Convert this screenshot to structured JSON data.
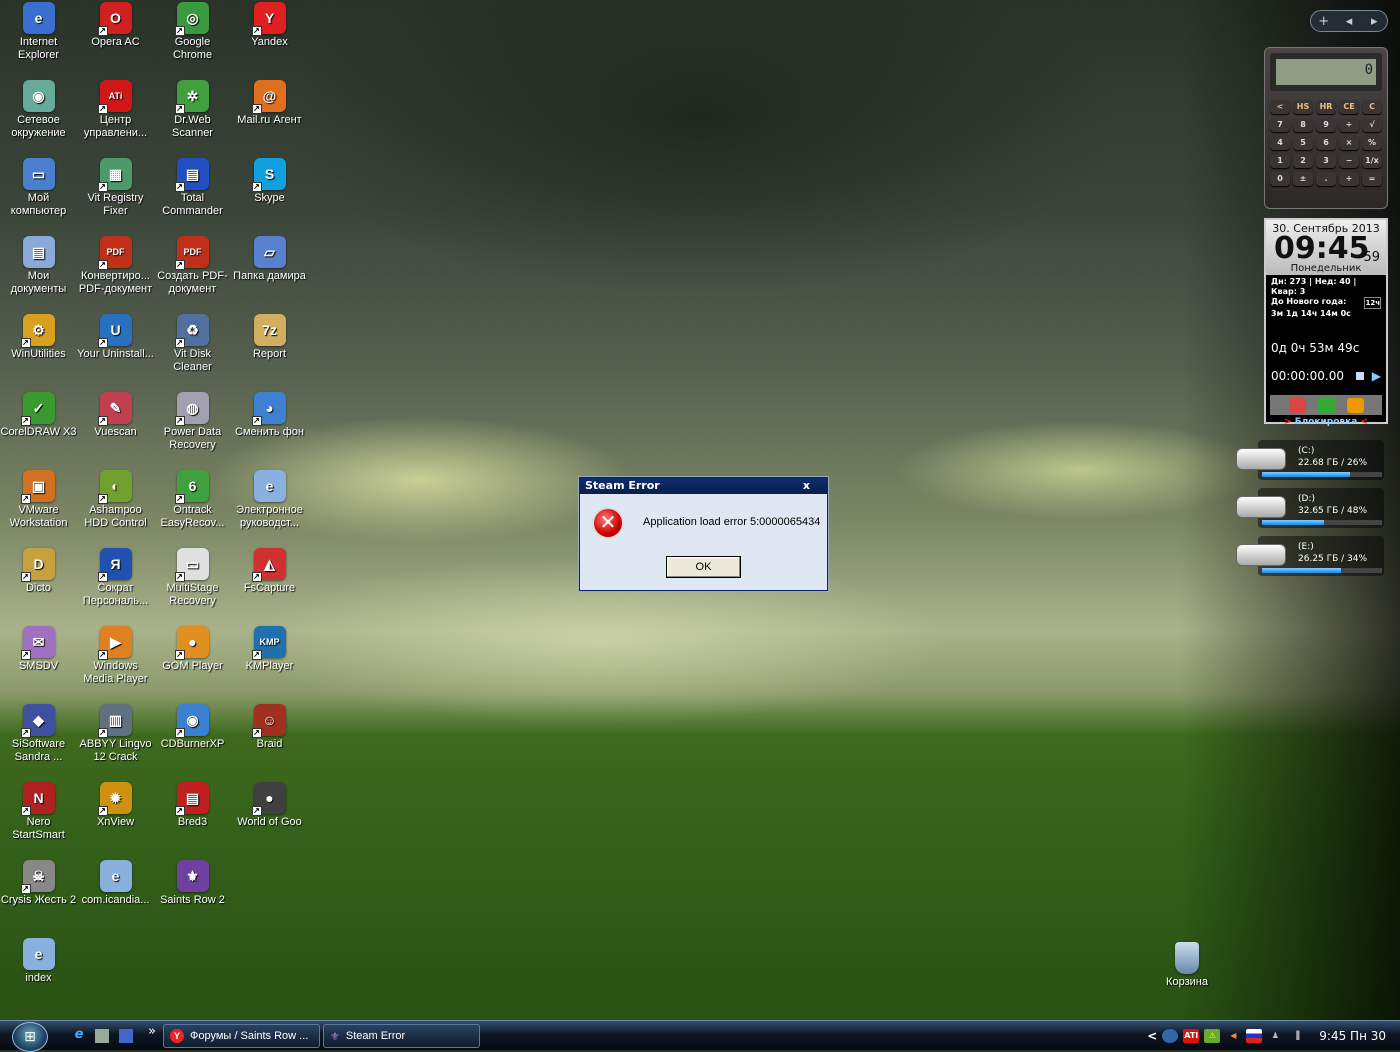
{
  "desktop_icons": [
    {
      "label": "Internet Explorer",
      "icon": "internet-explorer-icon",
      "color": "#3a6fd0",
      "glyph": "e",
      "col": 0,
      "row": 0,
      "shortcut": false
    },
    {
      "label": "Сетевое окружение",
      "icon": "network-places-icon",
      "color": "#6a9",
      "glyph": "◉",
      "col": 0,
      "row": 1,
      "shortcut": false
    },
    {
      "label": "Мой компьютер",
      "icon": "my-computer-icon",
      "color": "#4a7fd0",
      "glyph": "▭",
      "col": 0,
      "row": 2,
      "shortcut": false
    },
    {
      "label": "Мои документы",
      "icon": "my-documents-icon",
      "color": "#8aa8d8",
      "glyph": "▤",
      "col": 0,
      "row": 3,
      "shortcut": false
    },
    {
      "label": "WinUtilities",
      "icon": "winutilities-icon",
      "color": "#d9a020",
      "glyph": "⚙",
      "col": 0,
      "row": 4,
      "shortcut": true
    },
    {
      "label": "CorelDRAW X3",
      "icon": "coreldraw-icon",
      "color": "#3a9a30",
      "glyph": "✓",
      "col": 0,
      "row": 5,
      "shortcut": true
    },
    {
      "label": "VMware Workstation",
      "icon": "vmware-icon",
      "color": "#d07020",
      "glyph": "▣",
      "col": 0,
      "row": 6,
      "shortcut": true
    },
    {
      "label": "Dicto",
      "icon": "dicto-icon",
      "color": "#c8a040",
      "glyph": "D",
      "col": 0,
      "row": 7,
      "shortcut": true
    },
    {
      "label": "SMSDV",
      "icon": "smsdv-icon",
      "color": "#a070c0",
      "glyph": "✉",
      "col": 0,
      "row": 8,
      "shortcut": true
    },
    {
      "label": "SiSoftware Sandra ...",
      "icon": "sandra-icon",
      "color": "#4050a0",
      "glyph": "◆",
      "col": 0,
      "row": 9,
      "shortcut": true
    },
    {
      "label": "Nero StartSmart",
      "icon": "nero-icon",
      "color": "#b02020",
      "glyph": "N",
      "col": 0,
      "row": 10,
      "shortcut": true
    },
    {
      "label": "Crysis Жесть 2",
      "icon": "crysis-icon",
      "color": "#888",
      "glyph": "☠",
      "col": 0,
      "row": 11,
      "shortcut": true
    },
    {
      "label": "index",
      "icon": "web-file-icon",
      "color": "#8ab0e0",
      "glyph": "e",
      "col": 0,
      "row": 12,
      "shortcut": false
    },
    {
      "label": "Opera AC",
      "icon": "opera-icon",
      "color": "#d02020",
      "glyph": "O",
      "col": 1,
      "row": 0,
      "shortcut": true
    },
    {
      "label": "Центр управлени...",
      "icon": "ati-icon",
      "color": "#d01818",
      "glyph": "ATi",
      "col": 1,
      "row": 1,
      "shortcut": true
    },
    {
      "label": "Vit Registry Fixer",
      "icon": "registry-fixer-icon",
      "color": "#4a9a6a",
      "glyph": "▦",
      "col": 1,
      "row": 2,
      "shortcut": true
    },
    {
      "label": "Конвертиро... PDF-документ",
      "icon": "pdf-converter-icon",
      "color": "#c03018",
      "glyph": "PDF",
      "col": 1,
      "row": 3,
      "shortcut": true
    },
    {
      "label": "Your Uninstall...",
      "icon": "uninstaller-icon",
      "color": "#2a70c0",
      "glyph": "U",
      "col": 1,
      "row": 4,
      "shortcut": true
    },
    {
      "label": "Vuescan",
      "icon": "vuescan-icon",
      "color": "#c04050",
      "glyph": "✎",
      "col": 1,
      "row": 5,
      "shortcut": true
    },
    {
      "label": "Ashampoo HDD Control",
      "icon": "ashampoo-icon",
      "color": "#70a030",
      "glyph": "◐",
      "col": 1,
      "row": 6,
      "shortcut": true
    },
    {
      "label": "Сократ Персональ...",
      "icon": "sokrat-icon",
      "color": "#2050b0",
      "glyph": "Я",
      "col": 1,
      "row": 7,
      "shortcut": true
    },
    {
      "label": "Windows Media Player",
      "icon": "media-player-icon",
      "color": "#e08020",
      "glyph": "▶",
      "col": 1,
      "row": 8,
      "shortcut": true
    },
    {
      "label": "ABBYY Lingvo 12 Crack",
      "icon": "lingvo-icon",
      "color": "#607080",
      "glyph": "▥",
      "col": 1,
      "row": 9,
      "shortcut": true
    },
    {
      "label": "XnView",
      "icon": "xnview-icon",
      "color": "#d09010",
      "glyph": "✹",
      "col": 1,
      "row": 10,
      "shortcut": true
    },
    {
      "label": "com.icandia...",
      "icon": "web-file-icon",
      "color": "#8ab0e0",
      "glyph": "e",
      "col": 1,
      "row": 11,
      "shortcut": false
    },
    {
      "label": "Google Chrome",
      "icon": "chrome-icon",
      "color": "#3a9a40",
      "glyph": "◎",
      "col": 2,
      "row": 0,
      "shortcut": true
    },
    {
      "label": "Dr.Web Scanner",
      "icon": "drweb-icon",
      "color": "#40a040",
      "glyph": "✲",
      "col": 2,
      "row": 1,
      "shortcut": true
    },
    {
      "label": "Total Commander",
      "icon": "total-commander-icon",
      "color": "#2050c0",
      "glyph": "▤",
      "col": 2,
      "row": 2,
      "shortcut": true
    },
    {
      "label": "Создать PDF-документ",
      "icon": "create-pdf-icon",
      "color": "#c03018",
      "glyph": "PDF",
      "col": 2,
      "row": 3,
      "shortcut": true
    },
    {
      "label": "Vit Disk Cleaner",
      "icon": "disk-cleaner-icon",
      "color": "#5070a0",
      "glyph": "♻",
      "col": 2,
      "row": 4,
      "shortcut": true
    },
    {
      "label": "Power Data Recovery",
      "icon": "data-recovery-icon",
      "color": "#a0a0b0",
      "glyph": "◍",
      "col": 2,
      "row": 5,
      "shortcut": true
    },
    {
      "label": "Ontrack EasyRecov...",
      "icon": "ontrack-icon",
      "color": "#40a040",
      "glyph": "6",
      "col": 2,
      "row": 6,
      "shortcut": true
    },
    {
      "label": "MultiStage Recovery",
      "icon": "multistage-icon",
      "color": "#e0e0e0",
      "glyph": "▭",
      "col": 2,
      "row": 7,
      "shortcut": true
    },
    {
      "label": "GOM Player",
      "icon": "gom-player-icon",
      "color": "#e09020",
      "glyph": "●",
      "col": 2,
      "row": 8,
      "shortcut": true
    },
    {
      "label": "CDBurnerXP",
      "icon": "cdburner-icon",
      "color": "#3a80d0",
      "glyph": "◉",
      "col": 2,
      "row": 9,
      "shortcut": true
    },
    {
      "label": "Bred3",
      "icon": "bred-icon",
      "color": "#c02020",
      "glyph": "▤",
      "col": 2,
      "row": 10,
      "shortcut": true
    },
    {
      "label": "Saints Row 2",
      "icon": "saints-row-icon",
      "color": "#7040a0",
      "glyph": "⚜",
      "col": 2,
      "row": 11,
      "shortcut": false
    },
    {
      "label": "Yandex",
      "icon": "yandex-icon",
      "color": "#e02020",
      "glyph": "Y",
      "col": 3,
      "row": 0,
      "shortcut": true
    },
    {
      "label": "Mail.ru Агент",
      "icon": "mailru-agent-icon",
      "color": "#e07020",
      "glyph": "@",
      "col": 3,
      "row": 1,
      "shortcut": true
    },
    {
      "label": "Skype",
      "icon": "skype-icon",
      "color": "#10a0e0",
      "glyph": "S",
      "col": 3,
      "row": 2,
      "shortcut": true
    },
    {
      "label": "Папка дамира",
      "icon": "folder-icon",
      "color": "#5a80d0",
      "glyph": "▱",
      "col": 3,
      "row": 3,
      "shortcut": false
    },
    {
      "label": "Report",
      "icon": "7z-archive-icon",
      "color": "#d0b060",
      "glyph": "7z",
      "col": 3,
      "row": 4,
      "shortcut": false
    },
    {
      "label": "Сменить фон",
      "icon": "change-wallpaper-icon",
      "color": "#4080d0",
      "glyph": "◕",
      "col": 3,
      "row": 5,
      "shortcut": true
    },
    {
      "label": "Электронное руководст...",
      "icon": "web-file-icon",
      "color": "#8ab0e0",
      "glyph": "e",
      "col": 3,
      "row": 6,
      "shortcut": false
    },
    {
      "label": "FsCapture",
      "icon": "fscapture-icon",
      "color": "#d03030",
      "glyph": "◭",
      "col": 3,
      "row": 7,
      "shortcut": true
    },
    {
      "label": "KMPlayer",
      "icon": "kmplayer-icon",
      "color": "#2070b0",
      "glyph": "KMP",
      "col": 3,
      "row": 8,
      "shortcut": true
    },
    {
      "label": "Braid",
      "icon": "braid-icon",
      "color": "#a03020",
      "glyph": "☺",
      "col": 3,
      "row": 9,
      "shortcut": true
    },
    {
      "label": "World of Goo",
      "icon": "world-of-goo-icon",
      "color": "#404040",
      "glyph": "●",
      "col": 3,
      "row": 10,
      "shortcut": true
    }
  ],
  "recycle_bin": {
    "label": "Корзина",
    "icon": "recycle-bin-icon"
  },
  "dialog": {
    "title": "Steam Error",
    "close": "x",
    "message": "Application load error 5:0000065434",
    "ok_label": "OK"
  },
  "gadget_controls": {
    "add": "+",
    "prev": "◂",
    "next": "▸"
  },
  "calculator": {
    "display": "0",
    "keys": [
      "<",
      "HS",
      "HR",
      "CE",
      "C",
      "7",
      "8",
      "9",
      "÷",
      "√",
      "4",
      "5",
      "6",
      "×",
      "%",
      "1",
      "2",
      "3",
      "−",
      "1/x",
      "0",
      "±",
      ".",
      "+",
      "="
    ]
  },
  "clock": {
    "date": "30. Сентябрь 2013",
    "time": "09:45",
    "seconds": "59",
    "weekday": "Понедельник",
    "stats": "Дн: 273 | Нед: 40 | Квар: 3",
    "new_year_label": "До Нового года:",
    "new_year_countdown": "3м 1д 14ч 14м 0с",
    "format_badge": "12ч",
    "timer": "0д 0ч 53м 49с",
    "stopwatch": "00:00:00.00",
    "lock_label": "Блокировка",
    "lock_left": ">",
    "lock_right": "<"
  },
  "drives": [
    {
      "name": "(C:)",
      "info": "22.68 ГБ / 26%",
      "fill": 0.73
    },
    {
      "name": "(D:)",
      "info": "32.65 ГБ / 48%",
      "fill": 0.52
    },
    {
      "name": "(E:)",
      "info": "26.25 ГБ / 34%",
      "fill": 0.66
    }
  ],
  "taskbar": {
    "start": "⊞",
    "quick_launch_more": "»",
    "buttons": [
      {
        "label": "Форумы / Saints Row ...",
        "icon": "yandex-icon"
      },
      {
        "label": "Steam Error",
        "icon": "steam-saints-row-icon"
      }
    ],
    "tray_expand": "<",
    "clock": "9:45 Пн 30"
  },
  "colors": {
    "dialog_title": "#0c2d6e",
    "accent": "#18e"
  }
}
